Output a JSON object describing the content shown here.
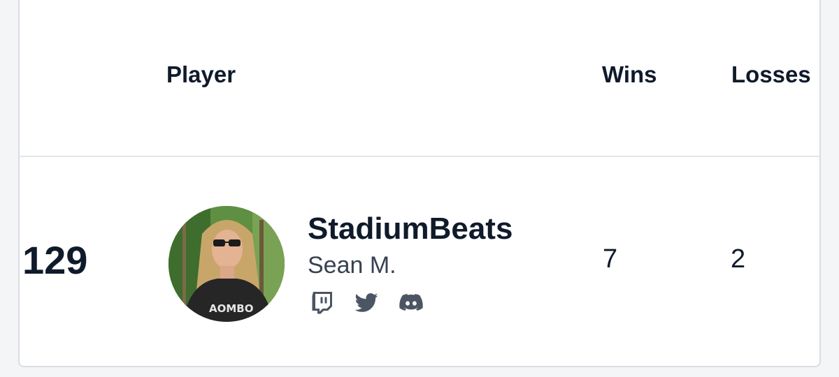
{
  "table": {
    "headers": {
      "player": "Player",
      "wins": "Wins",
      "losses": "Losses"
    },
    "rows": [
      {
        "rank": "129",
        "username": "StadiumBeats",
        "real_name": "Sean M.",
        "wins": "7",
        "losses": "2",
        "socials": [
          "twitch-icon",
          "twitter-icon",
          "discord-icon"
        ]
      }
    ]
  },
  "colors": {
    "text_primary": "#0f1a2b",
    "text_secondary": "#374151",
    "icon": "#4b5563",
    "divider": "#e3e6ea"
  }
}
